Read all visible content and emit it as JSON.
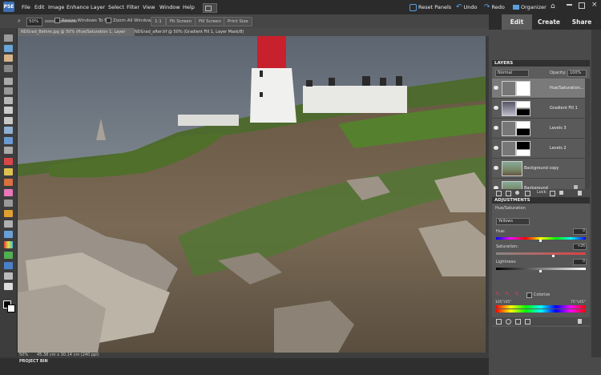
{
  "app": {
    "logo": "PSE"
  },
  "menu": [
    "File",
    "Edit",
    "Image",
    "Enhance",
    "Layer",
    "Select",
    "Filter",
    "View",
    "Window",
    "Help"
  ],
  "top_right": {
    "reset_panels": "Reset Panels",
    "undo": "Undo",
    "redo": "Redo",
    "organizer": "Organizer"
  },
  "options": {
    "zoom": "50%",
    "resize_windows": "Resize Windows To Fit",
    "zoom_all_windows": "Zoom All Windows",
    "btn_1to1": "1:1",
    "btn_fit": "Fit Screen",
    "btn_fill": "Fill Screen",
    "btn_print": "Print Size"
  },
  "mode_tabs": [
    "Edit",
    "Create",
    "Share"
  ],
  "doc_tabs": [
    "NDGrad_Before.jpg @ 50% (Hue/Saturation 1, Layer Mask/8) *",
    "NDGrad_after.tif @ 50% (Gradient Fill 1, Layer Mask/8) *"
  ],
  "status": {
    "zoom": "50%",
    "size": "45.38 cm x 30.14 cm (240 ppi)"
  },
  "project_bin": "PROJECT BIN",
  "layers_panel": {
    "title": "LAYERS",
    "blend_mode": "Normal",
    "opacity_label": "Opacity:",
    "opacity": "100%",
    "lock_label": "Lock:",
    "layers": [
      {
        "name": "Hue/Saturation..."
      },
      {
        "name": "Gradient Fill 1"
      },
      {
        "name": "Levels 3"
      },
      {
        "name": "Levels 2"
      },
      {
        "name": "Background copy"
      },
      {
        "name": "Background"
      }
    ]
  },
  "adjustments_panel": {
    "title": "ADJUSTMENTS",
    "subtitle": "Hue/Saturation",
    "channel": "Yellows",
    "hue_label": "Hue:",
    "hue_value": "0",
    "saturation_label": "Saturation:",
    "saturation_value": "+26",
    "lightness_label": "Lightness:",
    "lightness_value": "0",
    "colorize_label": "Colorize",
    "range_left": "105°/45°",
    "range_right": "75°\\/45°"
  }
}
